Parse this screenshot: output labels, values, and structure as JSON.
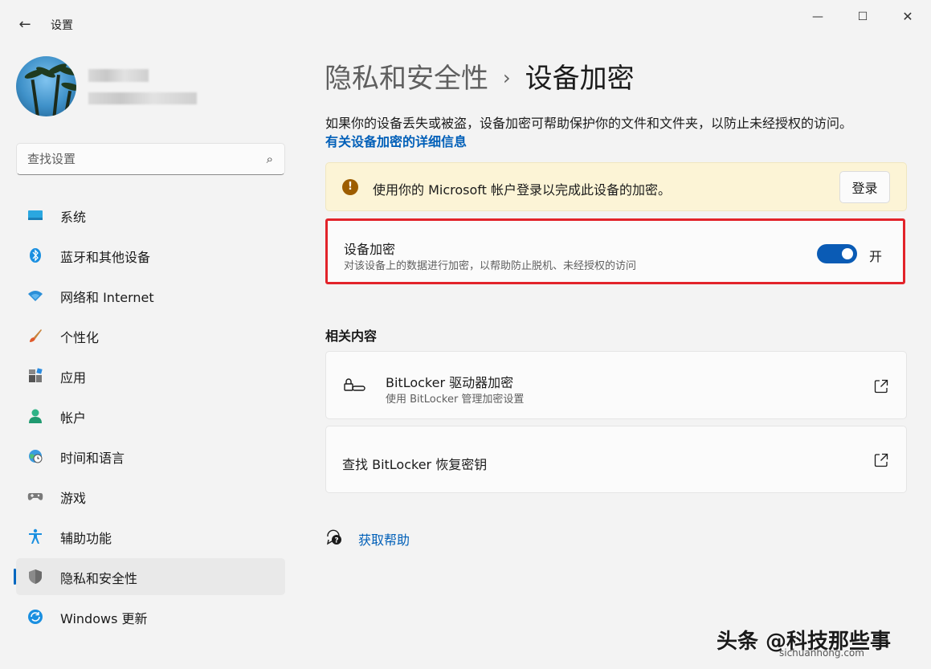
{
  "window": {
    "title": "设置",
    "back_glyph": "←",
    "minimize_glyph": "—",
    "maximize_glyph": "☐",
    "close_glyph": "✕"
  },
  "search": {
    "placeholder": "查找设置",
    "icon": "search-icon"
  },
  "sidebar": {
    "items": [
      {
        "label": "系统",
        "icon": "system-icon"
      },
      {
        "label": "蓝牙和其他设备",
        "icon": "bluetooth-icon"
      },
      {
        "label": "网络和 Internet",
        "icon": "wifi-icon"
      },
      {
        "label": "个性化",
        "icon": "brush-icon"
      },
      {
        "label": "应用",
        "icon": "apps-icon"
      },
      {
        "label": "帐户",
        "icon": "account-icon"
      },
      {
        "label": "时间和语言",
        "icon": "globe-clock-icon"
      },
      {
        "label": "游戏",
        "icon": "gamepad-icon"
      },
      {
        "label": "辅助功能",
        "icon": "accessibility-icon"
      },
      {
        "label": "隐私和安全性",
        "icon": "shield-icon",
        "active": true
      },
      {
        "label": "Windows 更新",
        "icon": "update-icon"
      }
    ]
  },
  "main": {
    "breadcrumb_parent": "隐私和安全性",
    "breadcrumb_sep": "›",
    "breadcrumb_current": "设备加密",
    "description": "如果你的设备丢失或被盗，设备加密可帮助保护你的文件和文件夹，以防止未经授权的访问。",
    "details_link": "有关设备加密的详细信息",
    "warning": {
      "icon_glyph": "!",
      "text": "使用你的 Microsoft 帐户登录以完成此设备的加密。",
      "button": "登录"
    },
    "encryption": {
      "title": "设备加密",
      "subtitle": "对该设备上的数据进行加密，以帮助防止脱机、未经授权的访问",
      "toggle_on": true,
      "toggle_label": "开"
    },
    "related_title": "相关内容",
    "related": [
      {
        "title": "BitLocker 驱动器加密",
        "subtitle": "使用 BitLocker 管理加密设置"
      },
      {
        "title": "查找 BitLocker 恢复密钥"
      }
    ],
    "help_link": "获取帮助"
  },
  "watermark": {
    "text": "头条 @科技那些事",
    "url": "sichuanhong.com"
  },
  "colors": {
    "accent": "#0067c0",
    "link": "#005fb8",
    "warning_bg": "#fcf4d6",
    "highlight_border": "#e2232a"
  }
}
